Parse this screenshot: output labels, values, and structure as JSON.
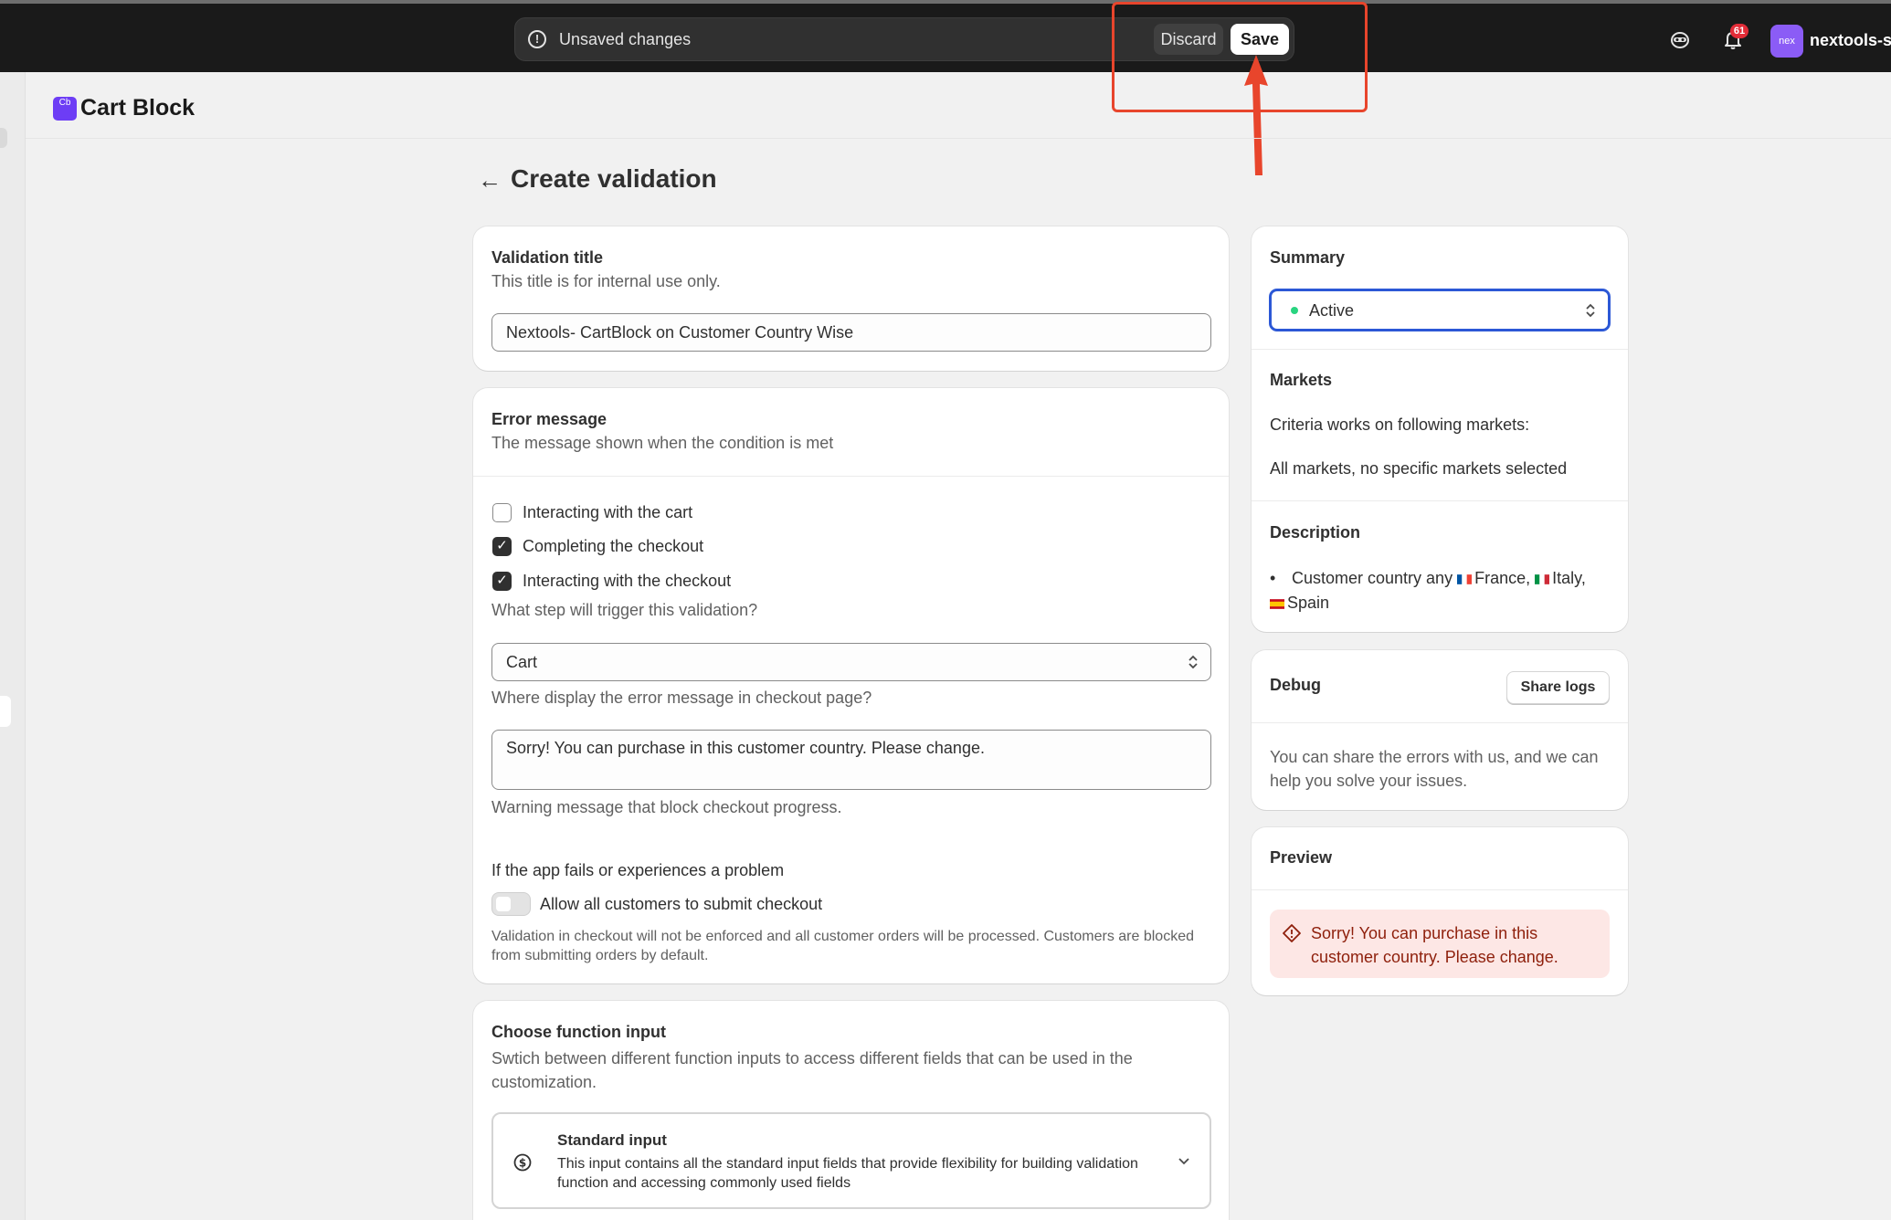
{
  "topbar": {
    "unsaved_label": "Unsaved changes",
    "discard_label": "Discard",
    "save_label": "Save",
    "notification_count": "61",
    "avatar_initials": "nex",
    "store_name": "nextools-su"
  },
  "app": {
    "logo_text": "Cb",
    "title": "Cart Block"
  },
  "page": {
    "title": "Create validation"
  },
  "validation_title": {
    "heading": "Validation title",
    "help": "This title is for internal use only.",
    "value": "Nextools- CartBlock on Customer Country Wise"
  },
  "error_message": {
    "heading": "Error message",
    "help": "The message shown when the condition is met",
    "triggers": [
      {
        "label": "Interacting with the cart",
        "checked": false
      },
      {
        "label": "Completing the checkout",
        "checked": true
      },
      {
        "label": "Interacting with the checkout",
        "checked": true
      }
    ],
    "trigger_help": "What step will trigger this validation?",
    "display_value": "Cart",
    "display_help": "Where display the error message in checkout page?",
    "message_value": "Sorry! You can purchase in this customer country. Please change.",
    "message_help": "Warning message that block checkout progress.",
    "fail_heading": "If the app fails or experiences a problem",
    "fail_toggle_label": "Allow all customers to submit checkout",
    "fail_help": "Validation in checkout will not be enforced and all customer orders will be processed. Customers are blocked from submitting orders by default."
  },
  "function_input": {
    "heading": "Choose function input",
    "help": "Swtich between different function inputs to access different fields that can be used in the customization.",
    "option_title": "Standard input",
    "option_desc": "This input contains all the standard input fields that provide flexibility for building validation function and accessing commonly used fields"
  },
  "summary": {
    "heading": "Summary",
    "status": "Active",
    "markets_heading": "Markets",
    "markets_line1": "Criteria works on following markets:",
    "markets_line2": "All markets, no specific markets selected",
    "description_heading": "Description",
    "description_prefix": "Customer country any",
    "countries": [
      "France,",
      "Italy,",
      "Spain"
    ]
  },
  "debug": {
    "heading": "Debug",
    "share_label": "Share logs",
    "text": "You can share the errors with us, and we can help you solve your issues."
  },
  "preview": {
    "heading": "Preview",
    "message": "Sorry! You can purchase in this customer country. Please change."
  },
  "colors": {
    "topbar": "#1a1a1a",
    "annotation": "#e8452c",
    "focus_ring": "#2c58d6",
    "active_dot": "#29d480",
    "critical_bg": "#fde7e5",
    "critical_text": "#8e1f0b"
  }
}
